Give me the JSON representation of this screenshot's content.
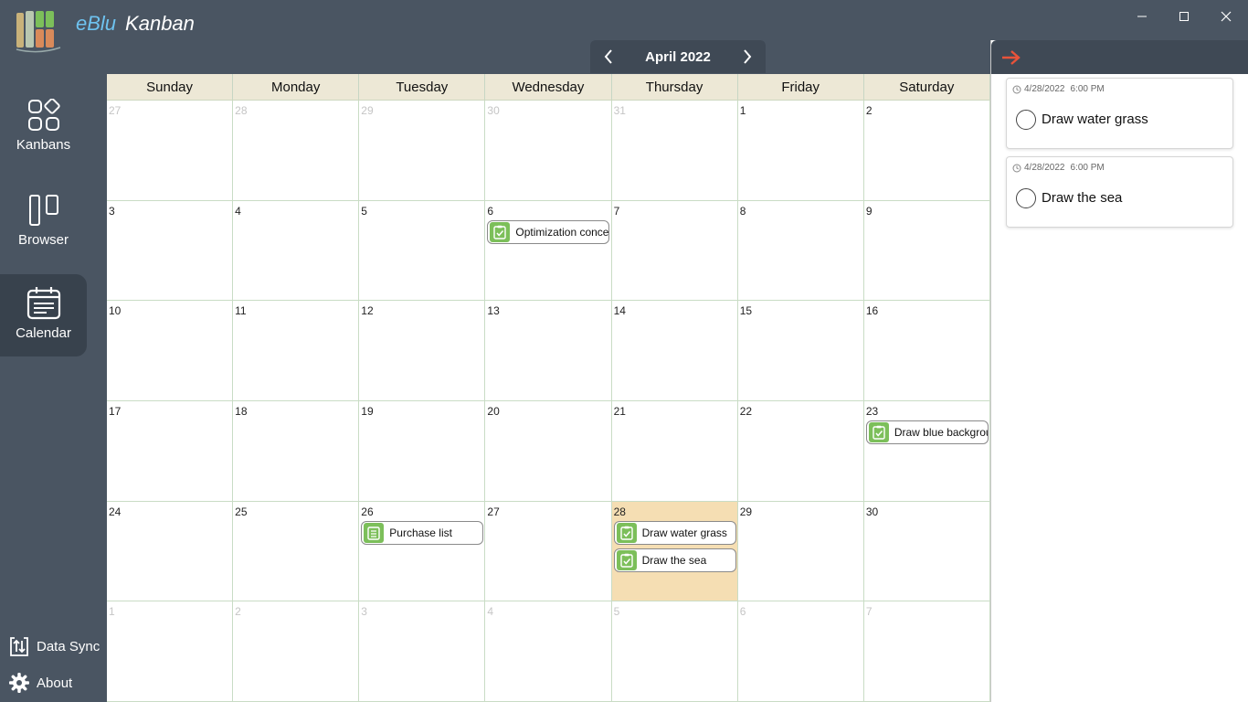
{
  "app": {
    "brand": "eBlu",
    "name": "Kanban"
  },
  "sidebar": {
    "items": [
      {
        "label": "Kanbans",
        "icon": "kanbans-icon"
      },
      {
        "label": "Browser",
        "icon": "browser-icon"
      },
      {
        "label": "Calendar",
        "icon": "calendar-icon",
        "active": true
      }
    ],
    "bottom": [
      {
        "label": "Data Sync",
        "icon": "data-sync-icon"
      },
      {
        "label": "About",
        "icon": "gear-icon"
      }
    ]
  },
  "calendar": {
    "month_label": "April 2022",
    "weekdays": [
      "Sunday",
      "Monday",
      "Tuesday",
      "Wednesday",
      "Thursday",
      "Friday",
      "Saturday"
    ],
    "weeks": [
      [
        "27",
        "28",
        "29",
        "30",
        "31",
        "1",
        "2"
      ],
      [
        "3",
        "4",
        "5",
        "6",
        "7",
        "8",
        "9"
      ],
      [
        "10",
        "11",
        "12",
        "13",
        "14",
        "15",
        "16"
      ],
      [
        "17",
        "18",
        "19",
        "20",
        "21",
        "22",
        "23"
      ],
      [
        "24",
        "25",
        "26",
        "27",
        "28",
        "29",
        "30"
      ],
      [
        "1",
        "2",
        "3",
        "4",
        "5",
        "6",
        "7"
      ]
    ],
    "other_month": [
      [
        0,
        0
      ],
      [
        0,
        1
      ],
      [
        0,
        2
      ],
      [
        0,
        3
      ],
      [
        0,
        4
      ],
      [
        5,
        0
      ],
      [
        5,
        1
      ],
      [
        5,
        2
      ],
      [
        5,
        3
      ],
      [
        5,
        4
      ],
      [
        5,
        5
      ],
      [
        5,
        6
      ]
    ],
    "today": [
      4,
      4
    ],
    "events": [
      {
        "week": 1,
        "day": 3,
        "slot": 0,
        "title": "Optimization conce",
        "icon": "task-check-icon"
      },
      {
        "week": 3,
        "day": 6,
        "slot": 0,
        "title": "Draw blue backgrou",
        "icon": "task-check-icon"
      },
      {
        "week": 4,
        "day": 2,
        "slot": 0,
        "title": "Purchase list",
        "icon": "list-icon"
      },
      {
        "week": 4,
        "day": 4,
        "slot": 0,
        "title": "Draw water grass",
        "icon": "task-check-icon"
      },
      {
        "week": 4,
        "day": 4,
        "slot": 1,
        "title": "Draw the sea",
        "icon": "task-check-icon"
      }
    ]
  },
  "panel": {
    "tasks": [
      {
        "date": "4/28/2022",
        "time": "6:00 PM",
        "title": "Draw water grass"
      },
      {
        "date": "4/28/2022",
        "time": "6:00 PM",
        "title": "Draw the sea"
      }
    ]
  },
  "colors": {
    "accent": "#6ec3f0",
    "close_arrow": "#e8533a",
    "today": "#f5deb3",
    "event_icon": "#7cbf5a"
  }
}
